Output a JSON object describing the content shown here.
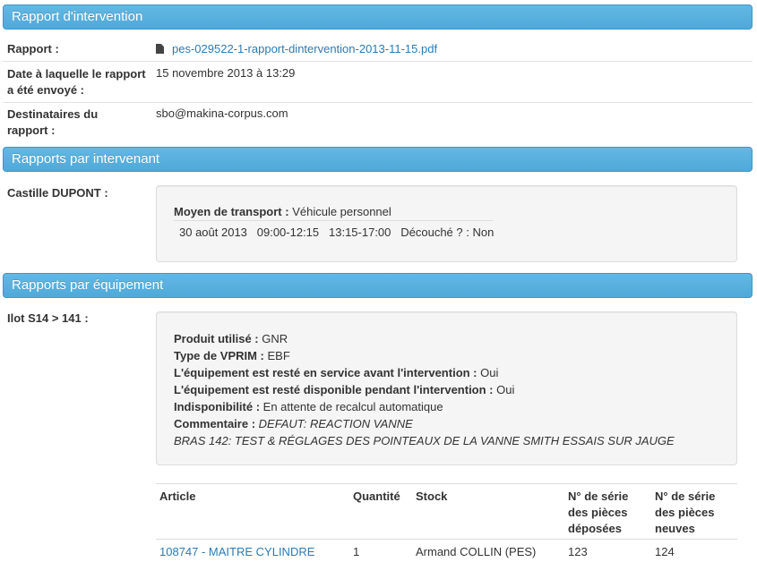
{
  "sections": {
    "rapport_intervention": "Rapport d'intervention",
    "rapports_intervenant": "Rapports par intervenant",
    "rapports_equipement": "Rapports par équipement"
  },
  "rapport": {
    "label": "Rapport :",
    "file_name": "pes-029522-1-rapport-dintervention-2013-11-15.pdf",
    "date_label_line1": "Date à laquelle le rapport",
    "date_label_line2": "a été envoyé :",
    "date_value": "15 novembre 2013 à 13:29",
    "dest_label_line1": "Destinataires du",
    "dest_label_line2": "rapport :",
    "dest_value": "sbo@makina-corpus.com"
  },
  "intervenant": {
    "name": "Castille DUPONT :",
    "transport_label": "Moyen de transport :",
    "transport_value": "Véhicule personnel",
    "date": "30 août 2013",
    "slot1": "09:00-12:15",
    "slot2": "13:15-17:00",
    "decouche_label": "Découché ? :",
    "decouche_value": "Non"
  },
  "equipement": {
    "name": "Ilot S14 > 141 :",
    "produit_label": "Produit utilisé :",
    "produit_value": "GNR",
    "type_label": "Type de VPRIM :",
    "type_value": "EBF",
    "service_label": "L'équipement est resté en service avant l'intervention :",
    "service_value": "Oui",
    "dispo_label": "L'équipement est resté disponible pendant l'intervention :",
    "dispo_value": "Oui",
    "indispo_label": "Indisponibilité :",
    "indispo_value": "En attente de recalcul automatique",
    "commentaire_label": "Commentaire :",
    "commentaire_line1": "DEFAUT: REACTION VANNE",
    "commentaire_line2": "BRAS 142: TEST & RÉGLAGES DES POINTEAUX DE LA VANNE SMITH ESSAIS SUR JAUGE"
  },
  "articles_table": {
    "headers": {
      "article": "Article",
      "quantite": "Quantité",
      "stock": "Stock",
      "serie_deposees_1": "N° de série",
      "serie_deposees_2": "des pièces",
      "serie_deposees_3": "déposées",
      "serie_neuves_1": "N° de série",
      "serie_neuves_2": "des pièces",
      "serie_neuves_3": "neuves"
    },
    "rows": [
      {
        "article": "108747 - MAITRE CYLINDRE",
        "quantite": "1",
        "stock": "Armand COLLIN (PES)",
        "serie_deposees": "123",
        "serie_neuves": "124"
      }
    ]
  }
}
